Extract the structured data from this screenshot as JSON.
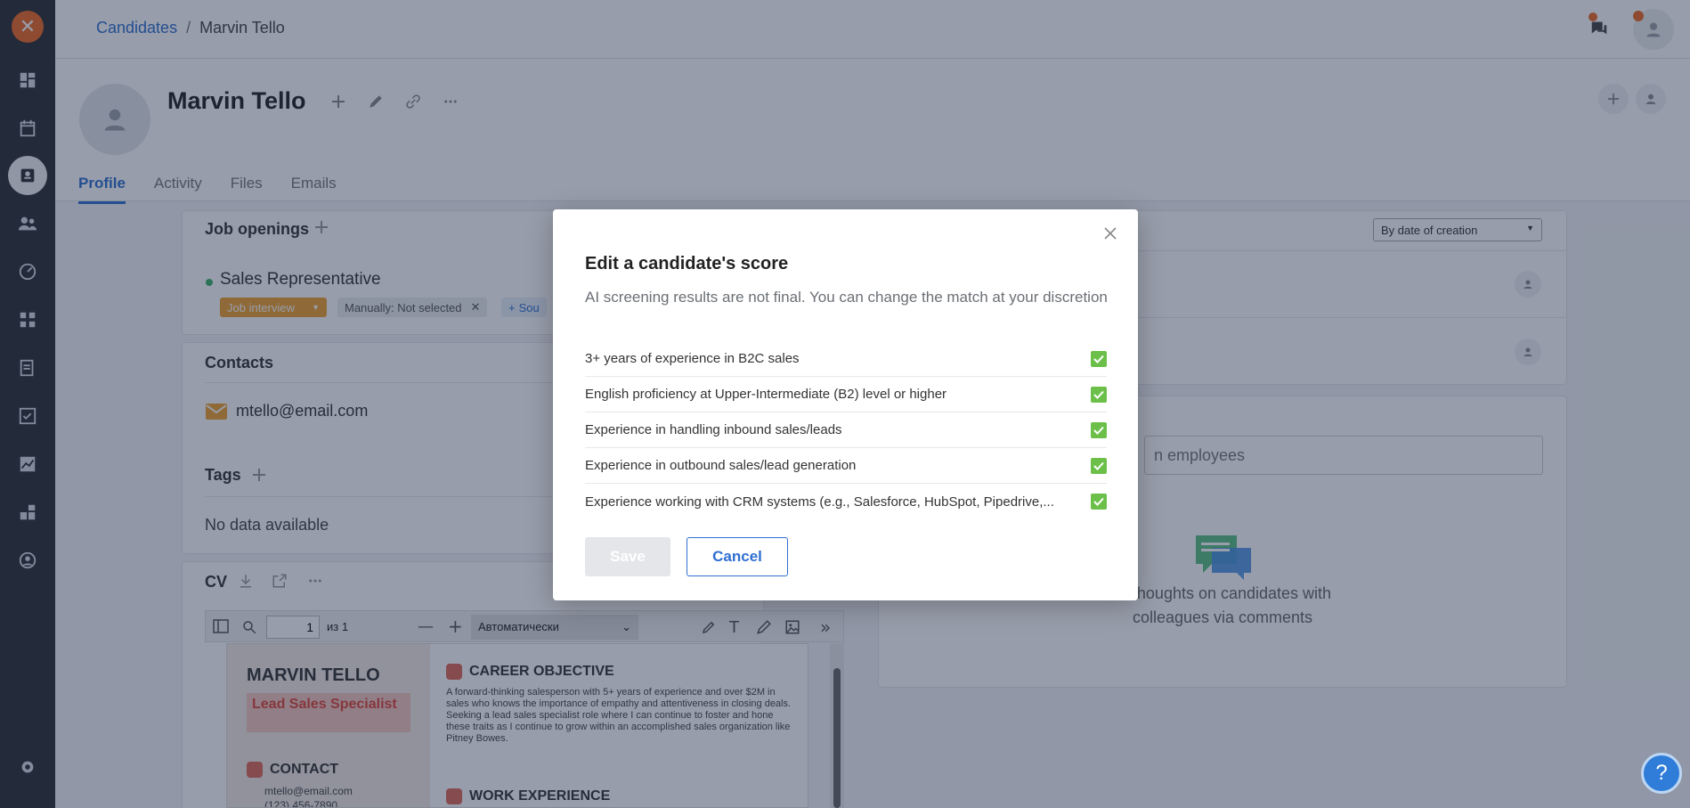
{
  "breadcrumb": {
    "parent": "Candidates",
    "separator": "/",
    "current": "Marvin Tello"
  },
  "candidate": {
    "name": "Marvin Tello"
  },
  "tabs": [
    "Profile",
    "Activity",
    "Files",
    "Emails"
  ],
  "job_openings": {
    "title": "Job openings",
    "position": "Sales Representative",
    "stage": "Job interview",
    "manual_status": "Manually: Not selected",
    "source_label": "Sou"
  },
  "contacts": {
    "title": "Contacts",
    "email": "mtello@email.com"
  },
  "tags": {
    "title": "Tags",
    "empty": "No data available"
  },
  "cv": {
    "title": "CV",
    "page_number": "1",
    "page_count": "из 1",
    "zoom": "Автоматически",
    "resume_name": "MARVIN TELLO",
    "resume_role": "Lead Sales Specialist",
    "section_contact": "CONTACT",
    "contact_email": "mtello@email.com",
    "contact_phone": "(123) 456-7890",
    "section_objective": "CAREER OBJECTIVE",
    "objective_text": "A forward-thinking salesperson with 5+ years of experience and over $2M in sales who knows the importance of empathy and attentiveness in closing deals. Seeking a lead sales specialist role where I can continue to foster and hone these traits as I continue to grow within an accomplished sales organization like Pitney Bowes.",
    "section_work": "WORK EXPERIENCE"
  },
  "right_panel": {
    "sort_label": "By date of creation",
    "search_placeholder_tail": "n employees",
    "comment_hint_line1": "ur thoughts on candidates with",
    "comment_hint_line2": "colleagues via comments"
  },
  "modal": {
    "title": "Edit a candidate's score",
    "description": "AI screening results are not final. You can change the match at your discretion",
    "criteria": [
      {
        "label": "3+ years of experience in B2C sales",
        "checked": true
      },
      {
        "label": "English proficiency at Upper-Intermediate (B2) level or higher",
        "checked": true
      },
      {
        "label": "Experience in handling inbound sales/leads",
        "checked": true
      },
      {
        "label": "Experience in outbound sales/lead generation",
        "checked": true
      },
      {
        "label": "Experience working with CRM systems (e.g., Salesforce, HubSpot, Pipedrive,...",
        "checked": true
      }
    ],
    "save_label": "Save",
    "cancel_label": "Cancel"
  },
  "help": {
    "label": "?"
  },
  "colors": {
    "accent": "#2f6fd1",
    "brand": "#ef6a23",
    "check": "#6cc04a",
    "stage": "#f0a330"
  },
  "icons": {
    "logo": "x-logo-icon"
  }
}
